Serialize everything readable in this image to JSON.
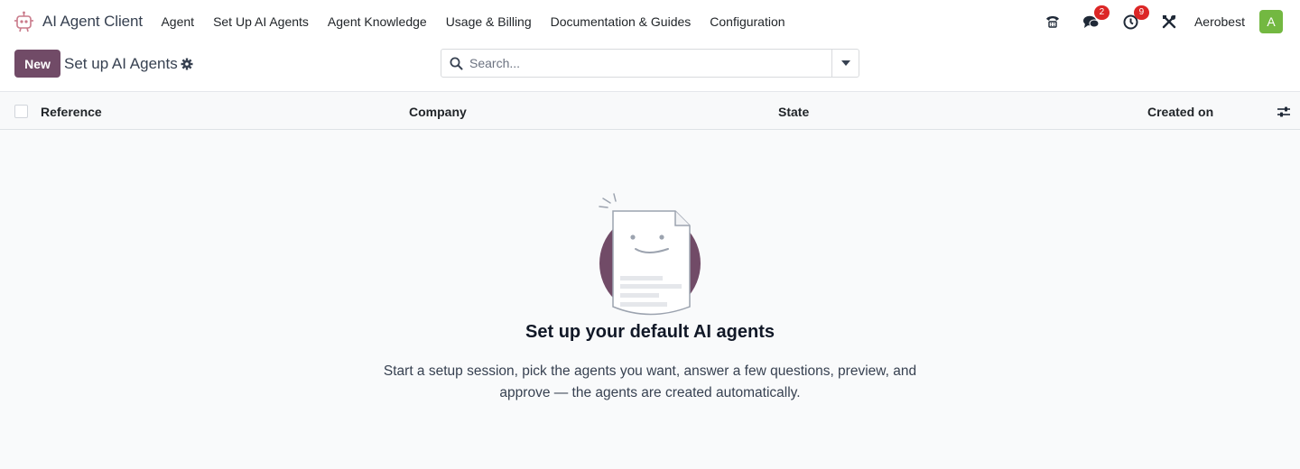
{
  "navbar": {
    "app_name": "AI Agent Client",
    "menu": [
      {
        "label": "Agent"
      },
      {
        "label": "Set Up AI Agents"
      },
      {
        "label": "Agent Knowledge"
      },
      {
        "label": "Usage & Billing"
      },
      {
        "label": "Documentation & Guides"
      },
      {
        "label": "Configuration"
      }
    ],
    "systray": {
      "phone_icon": "phone-icon",
      "messages_icon": "chat-bubbles-icon",
      "messages_count": "2",
      "activities_icon": "clock-icon",
      "activities_count": "9",
      "debug_icon": "tools-icon",
      "company": "Aerobest",
      "avatar_initial": "A"
    }
  },
  "control_panel": {
    "new_label": "New",
    "title": "Set up AI Agents",
    "search_placeholder": "Search..."
  },
  "list": {
    "columns": [
      {
        "label": "Reference"
      },
      {
        "label": "Company"
      },
      {
        "label": "State"
      },
      {
        "label": "Created on"
      }
    ]
  },
  "empty_state": {
    "title": "Set up your default AI agents",
    "line1": "Start a setup session, pick the agents you want, answer a few questions, preview, and",
    "line2": "approve — the agents are created automatically."
  },
  "colors": {
    "brand": "#714b67",
    "avatar": "#73b841",
    "badge": "#dc2626"
  }
}
